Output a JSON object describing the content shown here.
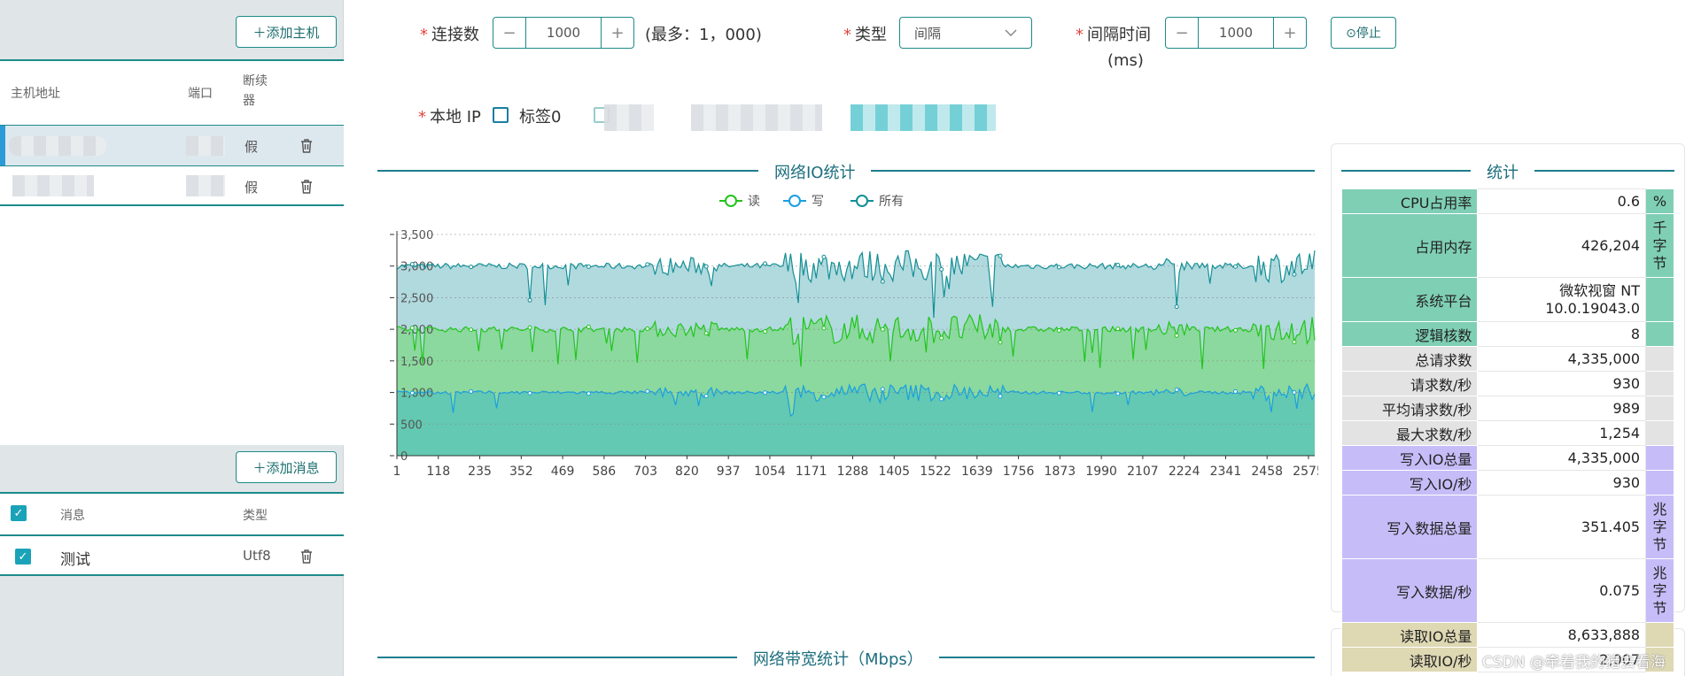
{
  "left": {
    "add_host_label": "＋添加主机",
    "host_columns": {
      "address": "主机地址",
      "port": "端口",
      "reconnect": "断续器"
    },
    "hosts": [
      {
        "reconnect": "假"
      },
      {
        "reconnect": "假"
      }
    ],
    "add_message_label": "＋添加消息",
    "message_columns": {
      "message": "消息",
      "type": "类型"
    },
    "messages": [
      {
        "name": "测试",
        "type": "Utf8"
      }
    ]
  },
  "form": {
    "connections_label": "连接数",
    "connections_value": "1000",
    "connections_max": "(最多：1，000)",
    "type_label": "类型",
    "type_value": "间隔",
    "interval_label": "间隔时间",
    "interval_unit": "(ms)",
    "interval_value": "1000",
    "stop_label": "⊙停止",
    "local_ip_label": "本地 IP",
    "tag_label": "标签0",
    "minus": "−",
    "plus": "+"
  },
  "sections": {
    "network_io": "网络IO统计",
    "stats": "统计",
    "bandwidth": "网络带宽统计（Mbps）"
  },
  "chart_data": {
    "type": "area",
    "title": "网络IO统计",
    "legend": [
      "读",
      "写",
      "所有"
    ],
    "legend_position": "top-center",
    "ylim": [
      0,
      3500
    ],
    "yticks": [
      0,
      500,
      1000,
      1500,
      2000,
      2500,
      3000,
      3500
    ],
    "ytick_labels": [
      "0",
      "500",
      "1,000",
      "1,500",
      "2,000",
      "2,500",
      "3,000",
      "3,500"
    ],
    "x_tick_labels": [
      "1",
      "118",
      "235",
      "352",
      "469",
      "586",
      "703",
      "820",
      "937",
      "1054",
      "1171",
      "1288",
      "1405",
      "1522",
      "1639",
      "1756",
      "1873",
      "1990",
      "2107",
      "2224",
      "2341",
      "2458",
      "2575"
    ],
    "x_range": [
      1,
      2600
    ],
    "grid": true,
    "series": [
      {
        "name": "读",
        "color": "#22c41b",
        "mean": 2000,
        "fill": "#8bd99e"
      },
      {
        "name": "写",
        "color": "#1a9fe0",
        "mean": 1000,
        "fill": "#63c9b2"
      },
      {
        "name": "所有",
        "color": "#138f95",
        "mean": 3000,
        "fill": "#b1dadf"
      }
    ]
  },
  "stats": [
    {
      "key": "CPU占用率",
      "value": "0.6",
      "unit": "%",
      "group": "g1"
    },
    {
      "key": "占用内存",
      "value": "426,204",
      "unit": "千字节",
      "group": "g1"
    },
    {
      "key": "系统平台",
      "value": "微软视窗 NT 10.0.19043.0",
      "unit": "",
      "group": "g1"
    },
    {
      "key": "逻辑核数",
      "value": "8",
      "unit": "",
      "group": "g1"
    },
    {
      "key": "总请求数",
      "value": "4,335,000",
      "unit": "",
      "group": "g2"
    },
    {
      "key": "请求数/秒",
      "value": "930",
      "unit": "",
      "group": "g2"
    },
    {
      "key": "平均请求数/秒",
      "value": "989",
      "unit": "",
      "group": "g2"
    },
    {
      "key": "最大求数/秒",
      "value": "1,254",
      "unit": "",
      "group": "g2"
    },
    {
      "key": "写入IO总量",
      "value": "4,335,000",
      "unit": "",
      "group": "g3"
    },
    {
      "key": "写入IO/秒",
      "value": "930",
      "unit": "",
      "group": "g3"
    },
    {
      "key": "写入数据总量",
      "value": "351.405",
      "unit": "兆字节",
      "group": "g3"
    },
    {
      "key": "写入数据/秒",
      "value": "0.075",
      "unit": "兆字节",
      "group": "g3"
    },
    {
      "key": "读取IO总量",
      "value": "8,633,888",
      "unit": "",
      "group": "g4"
    },
    {
      "key": "读取IO/秒",
      "value": "2,007",
      "unit": "",
      "group": "g4"
    }
  ],
  "watermark": "CSDN @牵着我的猪去看海"
}
